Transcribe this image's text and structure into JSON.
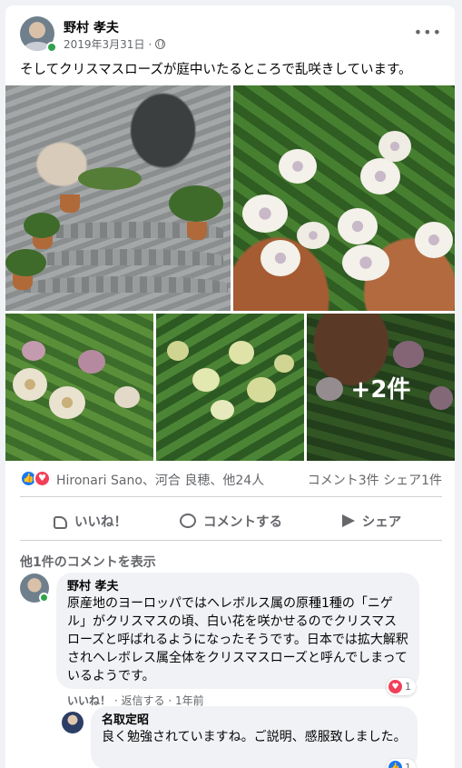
{
  "post": {
    "author": "野村 孝夫",
    "date": "2019年3月31日",
    "separator": "·",
    "more": "•••",
    "text": "そしてクリスマスローズが庭中いたるところで乱咲きしています。",
    "extra_photos": "+2件"
  },
  "reactions": {
    "names": "Hironari Sano、河合 良穂、他24人",
    "counts": "コメント3件  シェア1件"
  },
  "actions": {
    "like": "いいね！",
    "comment": "コメントする",
    "share": "シェア"
  },
  "comments_section": {
    "show_more": "他1件のコメントを表示"
  },
  "comments": [
    {
      "name": "野村 孝夫",
      "text": "原産地のヨーロッパではヘレボルス属の原種1種の「ニゲル」がクリスマスの頃、白い花を咲かせるのでクリスマスローズと呼ばれるようになったそうです。日本では拡大解釈されヘレボレス属全体をクリスマスローズと呼んでしまっているようです。",
      "like": "いいね！",
      "reply": "返信する",
      "time": "1年前",
      "reaction_count": "1"
    },
    {
      "name": "名取定昭",
      "text": "良く勉強されていますね。ご説明、感服致しました。",
      "reaction_count": "1"
    }
  ],
  "colors": {
    "like_blue": "#1877f2",
    "love_red": "#f33e58",
    "online_green": "#31a24c"
  }
}
